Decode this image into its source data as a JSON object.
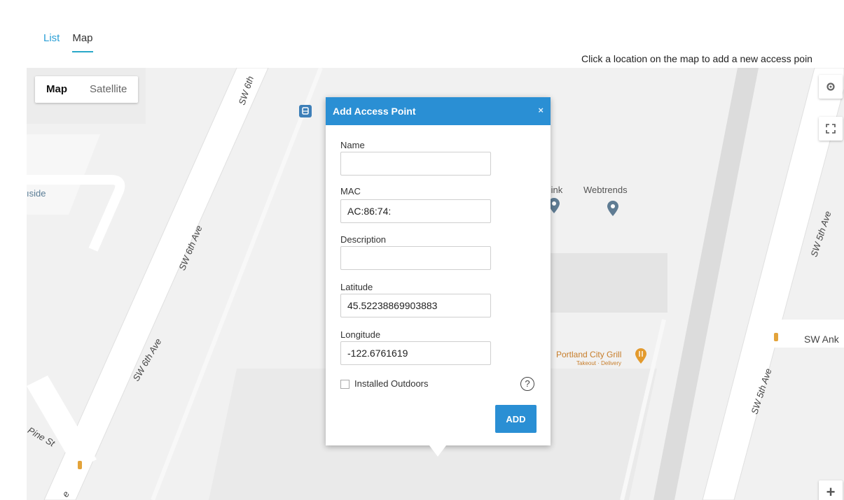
{
  "tabs": [
    {
      "label": "List",
      "active": false
    },
    {
      "label": "Map",
      "active": true
    }
  ],
  "hint": "Click a location on the map to add a new access poin",
  "map": {
    "type_control": {
      "map": "Map",
      "satellite": "Satellite"
    },
    "labels": {
      "riverside": "ıside",
      "pink": "Pink",
      "webtrends": "Webtrends",
      "grill_name": "Portland City Grill",
      "grill_sub": "Takeout · Delivery"
    },
    "streets": {
      "sw6th_top": "SW 6th",
      "sw6th_mid": "SW 6th Ave",
      "sw6th_low": "SW 6th Ave",
      "sw5th_top": "SW 5th Ave",
      "sw5th_low": "SW 5th Ave",
      "sw_ank": "SW Ank",
      "pine": "Pine St",
      "e_label": "e"
    },
    "controls": {
      "zoom_in": "+"
    }
  },
  "popup": {
    "title": "Add Access Point",
    "close": "×",
    "fields": {
      "name": {
        "label": "Name",
        "value": ""
      },
      "mac": {
        "label": "MAC",
        "value": "AC:86:74:"
      },
      "description": {
        "label": "Description",
        "value": ""
      },
      "latitude": {
        "label": "Latitude",
        "value": "45.52238869903883"
      },
      "longitude": {
        "label": "Longitude",
        "value": "-122.6761619"
      }
    },
    "installed_outdoors": {
      "label": "Installed Outdoors",
      "checked": false
    },
    "help": "?",
    "add_button": "ADD"
  },
  "colors": {
    "accent": "#2a8fd4",
    "tab_underline": "#29a8c9",
    "map_bg": "#f1f1f1",
    "pin": "#5f7c93",
    "grill": "#c77d2a"
  }
}
